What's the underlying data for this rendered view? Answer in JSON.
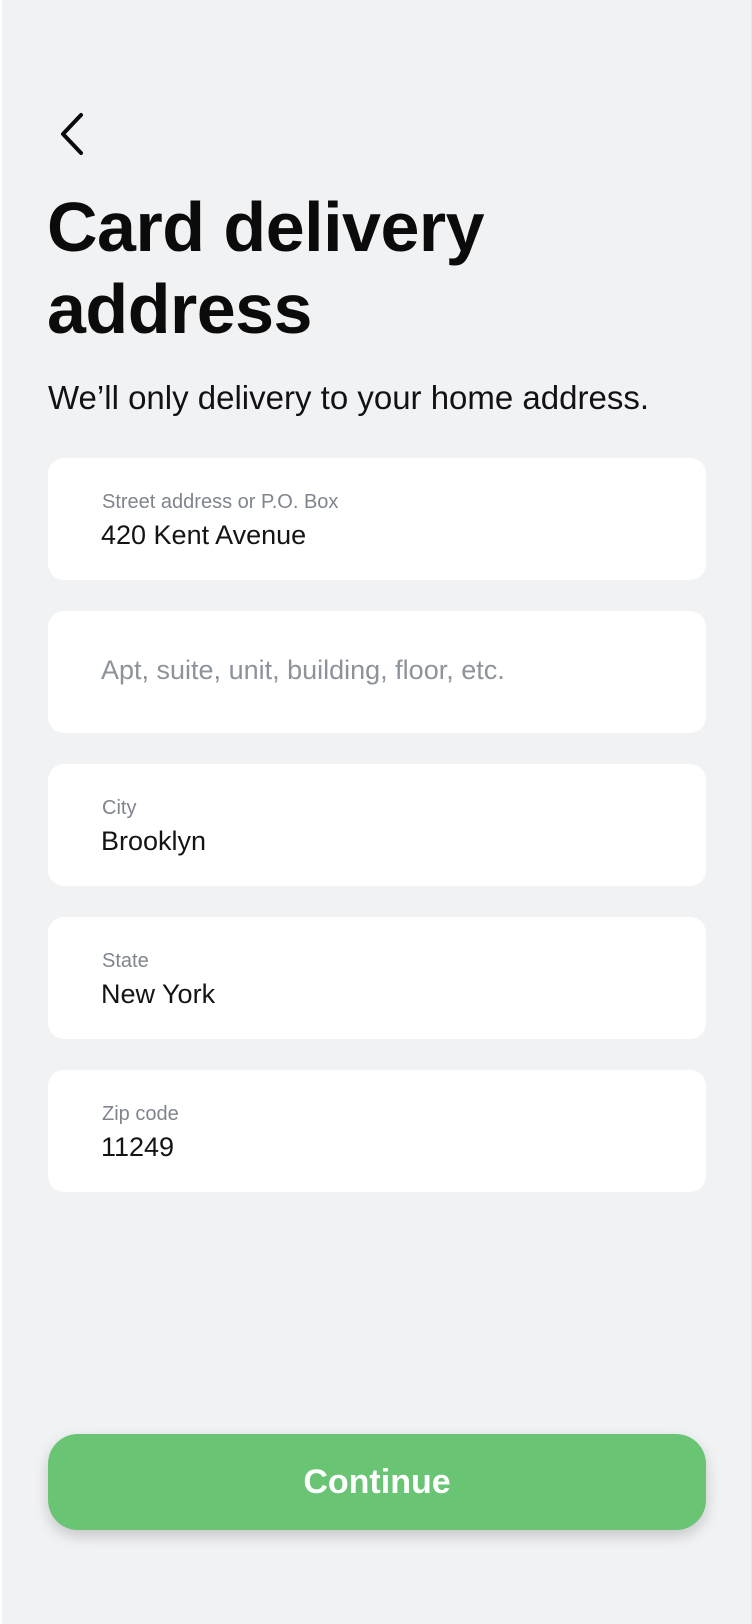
{
  "header": {
    "back_icon": "chevron-left-icon",
    "title": "Card delivery address",
    "subtitle": "We’ll only delivery to your home address."
  },
  "form": {
    "street": {
      "label": "Street address or P.O. Box",
      "value": "420 Kent Avenue"
    },
    "apt": {
      "placeholder": "Apt, suite, unit, building, floor, etc.",
      "value": ""
    },
    "city": {
      "label": "City",
      "value": "Brooklyn"
    },
    "state": {
      "label": "State",
      "value": "New York"
    },
    "zip": {
      "label": "Zip code",
      "value": "11249"
    }
  },
  "actions": {
    "continue_label": "Continue"
  },
  "colors": {
    "background": "#f1f2f4",
    "field_background": "#ffffff",
    "label_text": "#7f858d",
    "value_text": "#141416",
    "accent_green": "#69c574"
  }
}
